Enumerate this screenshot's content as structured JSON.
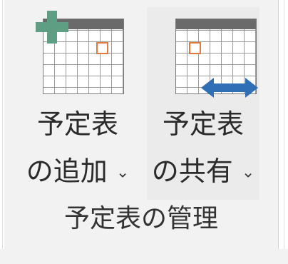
{
  "ribbon_group": {
    "label": "予定表の管理",
    "buttons": [
      {
        "line1": "予定表",
        "line2": "の追加",
        "chevron": "⌄",
        "icon": "calendar-add-icon"
      },
      {
        "line1": "予定表",
        "line2": "の共有",
        "chevron": "⌄",
        "icon": "calendar-share-icon"
      }
    ]
  },
  "colors": {
    "plus_icon": "#5e9e83",
    "share_arrow": "#2f6fb6",
    "calendar_header": "#6a6a6a",
    "calendar_mark": "#e07b3c",
    "ribbon_bg": "#f2f2f2"
  }
}
